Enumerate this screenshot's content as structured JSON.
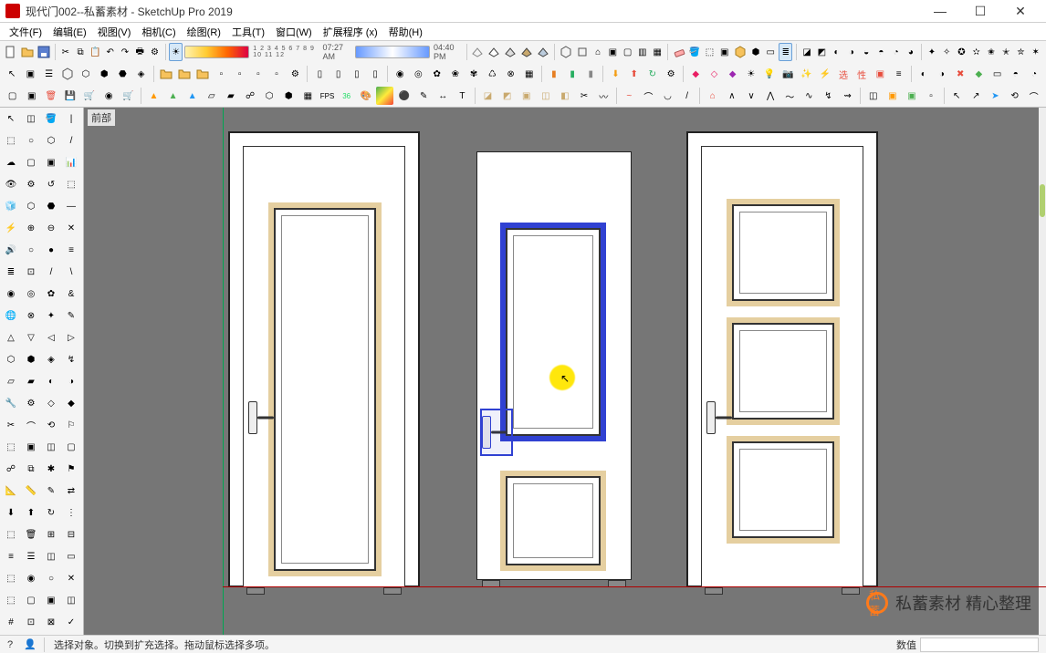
{
  "window": {
    "title": "现代门002--私蓄素材 - SketchUp Pro 2019",
    "min_label": "—",
    "max_label": "☐",
    "close_label": "✕"
  },
  "menu": [
    "文件(F)",
    "编辑(E)",
    "视图(V)",
    "相机(C)",
    "绘图(R)",
    "工具(T)",
    "窗口(W)",
    "扩展程序 (x)",
    "帮助(H)"
  ],
  "time_widget": {
    "time": "07:27 AM",
    "end": "04:40 PM"
  },
  "scale_labels": "1 2 3 4 5 6 7 8 9 10 11 12",
  "viewport_label": "前部",
  "status": {
    "hint": "选择对象。切换到扩充选择。拖动鼠标选择多项。",
    "measure_label": "数值"
  },
  "watermark": {
    "logo": "私蓄",
    "text": "私蓄素材 精心整理"
  }
}
